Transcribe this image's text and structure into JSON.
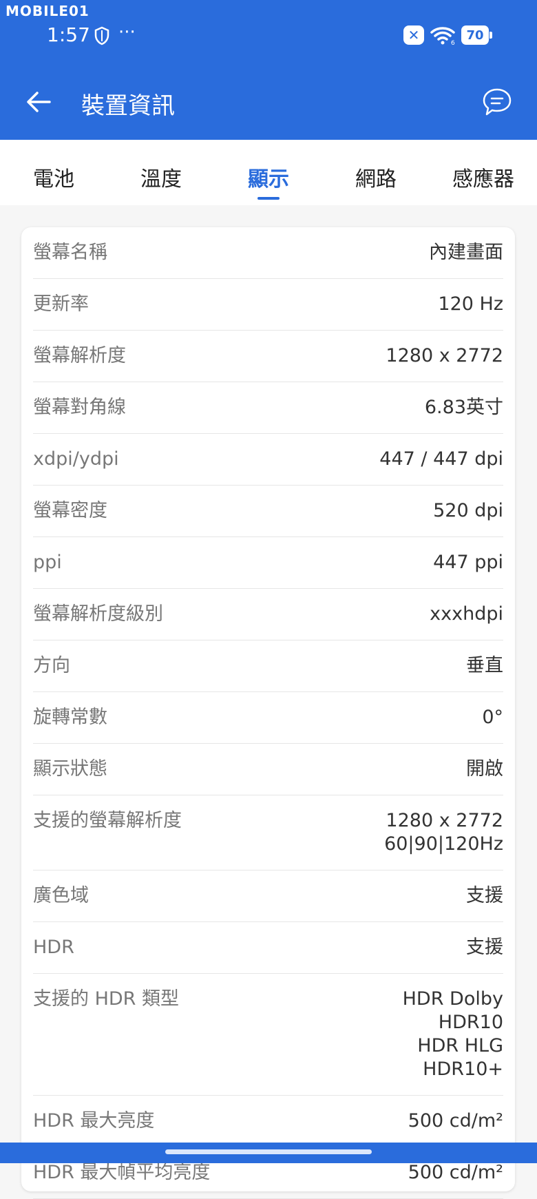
{
  "watermark": "MOBILE01",
  "status": {
    "time": "1:57",
    "dots": "···",
    "battery": "70",
    "signal_sub": "6"
  },
  "header": {
    "title": "裝置資訊"
  },
  "tabs": [
    "電池",
    "溫度",
    "顯示",
    "網路",
    "感應器"
  ],
  "active_tab": "顯示",
  "rows": [
    {
      "label": "螢幕名稱",
      "value": "內建畫面"
    },
    {
      "label": "更新率",
      "value": "120 Hz"
    },
    {
      "label": "螢幕解析度",
      "value": "1280 x 2772"
    },
    {
      "label": "螢幕對角線",
      "value": "6.83英寸"
    },
    {
      "label": "xdpi/ydpi",
      "value": "447 / 447 dpi"
    },
    {
      "label": "螢幕密度",
      "value": "520 dpi"
    },
    {
      "label": "ppi",
      "value": "447 ppi"
    },
    {
      "label": "螢幕解析度級別",
      "value": "xxxhdpi"
    },
    {
      "label": "方向",
      "value": "垂直"
    },
    {
      "label": "旋轉常數",
      "value": "0°"
    },
    {
      "label": "顯示狀態",
      "value": "開啟"
    },
    {
      "label": "支援的螢幕解析度",
      "value": "1280 x 2772\n60|90|120Hz"
    },
    {
      "label": "廣色域",
      "value": "支援"
    },
    {
      "label": "HDR",
      "value": "支援"
    },
    {
      "label": "支援的 HDR 類型",
      "value": "HDR Dolby\nHDR10\nHDR HLG\nHDR10+"
    },
    {
      "label": "HDR 最大亮度",
      "value": "500 cd/m²"
    },
    {
      "label": "HDR 最大幀平均亮度",
      "value": "500 cd/m²"
    }
  ],
  "colors": {
    "primary": "#2a6cdc",
    "background": "#f6f6f6"
  }
}
